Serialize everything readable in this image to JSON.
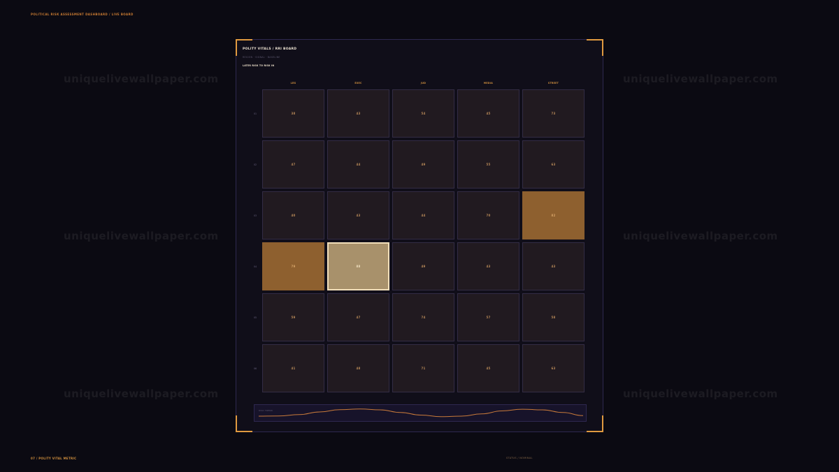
{
  "header": {
    "caption": "POLITICAL RISK ASSESSMENT DASHBOARD  /  LIVE BOARD"
  },
  "footer": {
    "left": "07 / POLITY VITAL METRIC",
    "right": "STATUS  /  NOMINAL"
  },
  "watermark": {
    "text": "uniquelivewallpaper.com"
  },
  "board": {
    "title": "POLITY VITALS  /  RRI BOARD",
    "subtitle": "REGION  ·  SIGNAL  ·  BASELINE",
    "legend": "LATER RISK TO  RISK IN",
    "columns": [
      "LEG",
      "EXEC",
      "JUD",
      "MEDIA",
      "STREET"
    ],
    "rows": [
      "01",
      "02",
      "03",
      "04",
      "05",
      "06"
    ],
    "cells": [
      [
        {
          "v": "38",
          "s": "normal"
        },
        {
          "v": "43",
          "s": "normal"
        },
        {
          "v": "54",
          "s": "normal"
        },
        {
          "v": "45",
          "s": "normal"
        },
        {
          "v": "73",
          "s": "normal"
        }
      ],
      [
        {
          "v": "47",
          "s": "normal"
        },
        {
          "v": "44",
          "s": "normal"
        },
        {
          "v": "49",
          "s": "normal"
        },
        {
          "v": "55",
          "s": "normal"
        },
        {
          "v": "63",
          "s": "normal"
        }
      ],
      [
        {
          "v": "40",
          "s": "normal"
        },
        {
          "v": "43",
          "s": "normal"
        },
        {
          "v": "44",
          "s": "normal"
        },
        {
          "v": "70",
          "s": "normal"
        },
        {
          "v": "82",
          "s": "hot"
        }
      ],
      [
        {
          "v": "79",
          "s": "hot"
        },
        {
          "v": "88",
          "s": "selected"
        },
        {
          "v": "49",
          "s": "normal"
        },
        {
          "v": "43",
          "s": "normal"
        },
        {
          "v": "43",
          "s": "normal"
        }
      ],
      [
        {
          "v": "59",
          "s": "normal"
        },
        {
          "v": "47",
          "s": "normal"
        },
        {
          "v": "74",
          "s": "normal"
        },
        {
          "v": "57",
          "s": "normal"
        },
        {
          "v": "58",
          "s": "normal"
        }
      ],
      [
        {
          "v": "41",
          "s": "normal"
        },
        {
          "v": "48",
          "s": "normal"
        },
        {
          "v": "71",
          "s": "normal"
        },
        {
          "v": "45",
          "s": "normal"
        },
        {
          "v": "63",
          "s": "normal"
        }
      ]
    ]
  },
  "trend": {
    "label": "RISK TREND",
    "color": "#c87a3a",
    "values": [
      0.2,
      0.22,
      0.35,
      0.6,
      0.82,
      0.88,
      0.8,
      0.55,
      0.3,
      0.15,
      0.2,
      0.42,
      0.7,
      0.86,
      0.8,
      0.55,
      0.25
    ]
  },
  "colors": {
    "accent": "#e09a40",
    "hot_cell": "#8e602f",
    "selected_cell": "#a8916b"
  }
}
